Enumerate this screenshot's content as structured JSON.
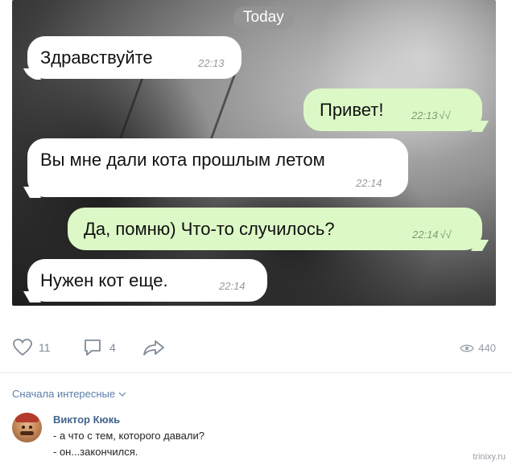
{
  "chat": {
    "date_chip": "Today",
    "messages": [
      {
        "text": "Здравствуйте",
        "time": "22:13",
        "side": "in"
      },
      {
        "text": "Привет!",
        "time": "22:13",
        "side": "out",
        "read": "√√"
      },
      {
        "text": "Вы мне дали кота прошлым летом",
        "time": "22:14",
        "side": "in"
      },
      {
        "text": "Да, помню) Что-то случилось?",
        "time": "22:14",
        "side": "out",
        "read": "√√"
      },
      {
        "text": "Нужен кот еще.",
        "time": "22:14",
        "side": "in"
      }
    ]
  },
  "post_actions": {
    "likes": "11",
    "comments": "4",
    "views": "440"
  },
  "comments_section": {
    "sort_label": "Сначала интересные",
    "comment": {
      "author": "Виктор Кюкь",
      "line1": "- а что с тем, которого давали?",
      "line2": "- он...закончился."
    }
  },
  "watermark": "trinixy.ru",
  "colors": {
    "incoming_bubble": "#ffffff",
    "outgoing_bubble": "#dcf8c6",
    "link_blue": "#42648b",
    "icon_gray": "#818c99"
  }
}
